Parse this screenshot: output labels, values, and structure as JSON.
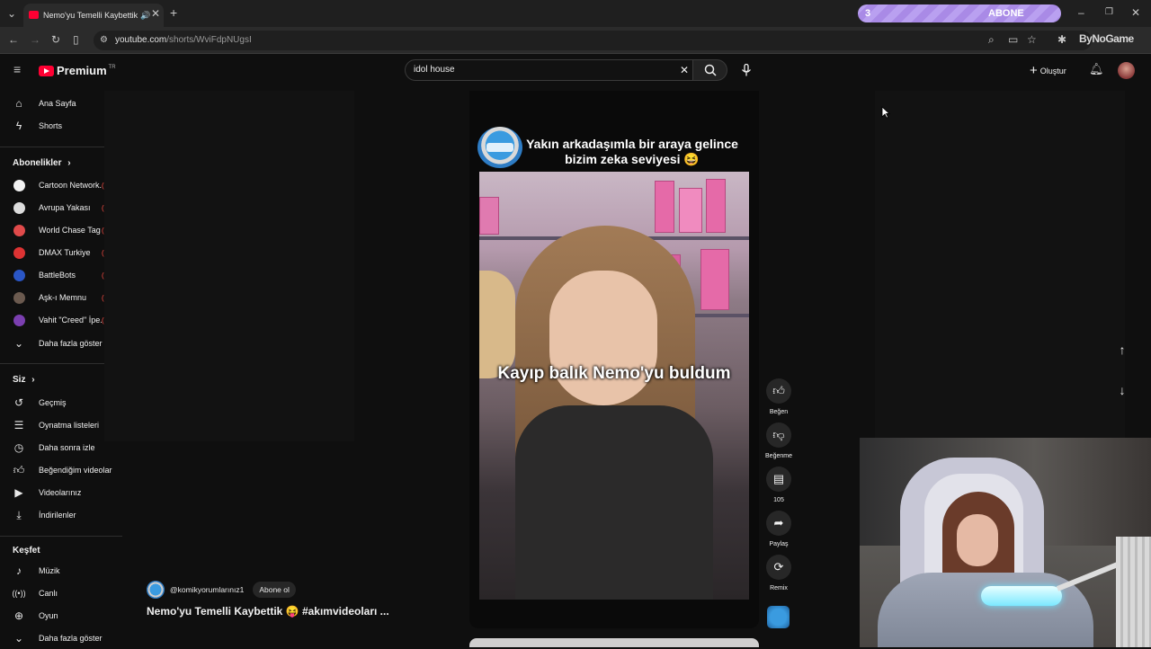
{
  "browser": {
    "tab_title": "Nemo'yu Temelli Kaybettik",
    "url_host": "youtube.com",
    "url_path": "/shorts/WviFdpNUgsI",
    "overlay_pill": {
      "count": "3",
      "label": "ABONE"
    },
    "extension_text": "ByNoGame"
  },
  "header": {
    "logo_text": "Premium",
    "logo_region": "TR",
    "search_value": "idol house",
    "create_label": "Oluştur"
  },
  "sidebar": {
    "main": [
      {
        "label": "Ana Sayfa",
        "icon": "home-icon"
      },
      {
        "label": "Shorts",
        "icon": "shorts-icon"
      }
    ],
    "subs_header": "Abonelikler",
    "subscriptions": [
      {
        "label": "Cartoon Network...",
        "color": "#f2f2f2"
      },
      {
        "label": "Avrupa Yakası",
        "color": "#dcdcdc"
      },
      {
        "label": "World Chase Tag",
        "color": "#e04a4a"
      },
      {
        "label": "DMAX Turkiye",
        "color": "#d33"
      },
      {
        "label": "BattleBots",
        "color": "#2a56c6"
      },
      {
        "label": "Aşk-ı Memnu",
        "color": "#6b5a4f"
      },
      {
        "label": "Vahit \"Creed\" İpe...",
        "color": "#7b3fb0"
      }
    ],
    "show_more_1": "Daha fazla göster",
    "you_header": "Siz",
    "you_items": [
      {
        "label": "Geçmiş",
        "icon": "history-icon"
      },
      {
        "label": "Oynatma listeleri",
        "icon": "playlist-icon"
      },
      {
        "label": "Daha sonra izle",
        "icon": "clock-icon"
      },
      {
        "label": "Beğendiğim videolar",
        "icon": "thumb-up-icon"
      },
      {
        "label": "Videolarınız",
        "icon": "video-icon"
      },
      {
        "label": "İndirilenler",
        "icon": "download-icon"
      }
    ],
    "explore_header": "Keşfet",
    "explore_items": [
      {
        "label": "Müzik",
        "icon": "music-icon"
      },
      {
        "label": "Canlı",
        "icon": "live-icon"
      },
      {
        "label": "Oyun",
        "icon": "gamepad-icon"
      }
    ],
    "show_more_2": "Daha fazla göster"
  },
  "short": {
    "top_title": "Yakın arkadaşımla bir araya gelince bizim zeka seviyesi 😆",
    "caption": "Kayıp balık Nemo'yu buldum",
    "channel": "@komikyorumlarınız1",
    "subscribe": "Abone ol",
    "title": "Nemo'yu Temelli Kaybettik 😝 #akımvideoları ..."
  },
  "actions": {
    "like": "Beğen",
    "dislike": "Beğenme",
    "comments": "105",
    "share": "Paylaş",
    "remix": "Remix"
  },
  "colors": {
    "accent": "#ff0033",
    "background": "#0f0f0f",
    "pill": "#b9a0f0"
  }
}
